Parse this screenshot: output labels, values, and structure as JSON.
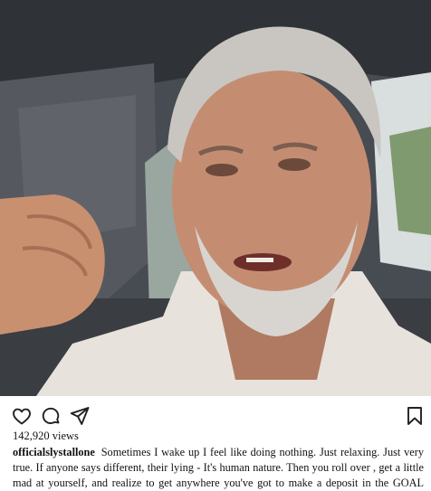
{
  "post": {
    "username": "officialslystallone",
    "caption": "Sometimes I wake up I feel like doing nothing. Just relaxing. Just very true. If anyone says different, their lying - It's human nature. Then you roll over , get a little mad at yourself, and realize to get anywhere you've got to make a deposit in the GOAL BANK, so I'll go back to my favorite phrase and do it !!",
    "views": "142,920 views"
  },
  "icons": {
    "like": "heart-icon",
    "comment": "comment-icon",
    "share": "send-icon",
    "save": "bookmark-icon"
  },
  "colors": {
    "text": "#111111",
    "icon": "#222222"
  }
}
